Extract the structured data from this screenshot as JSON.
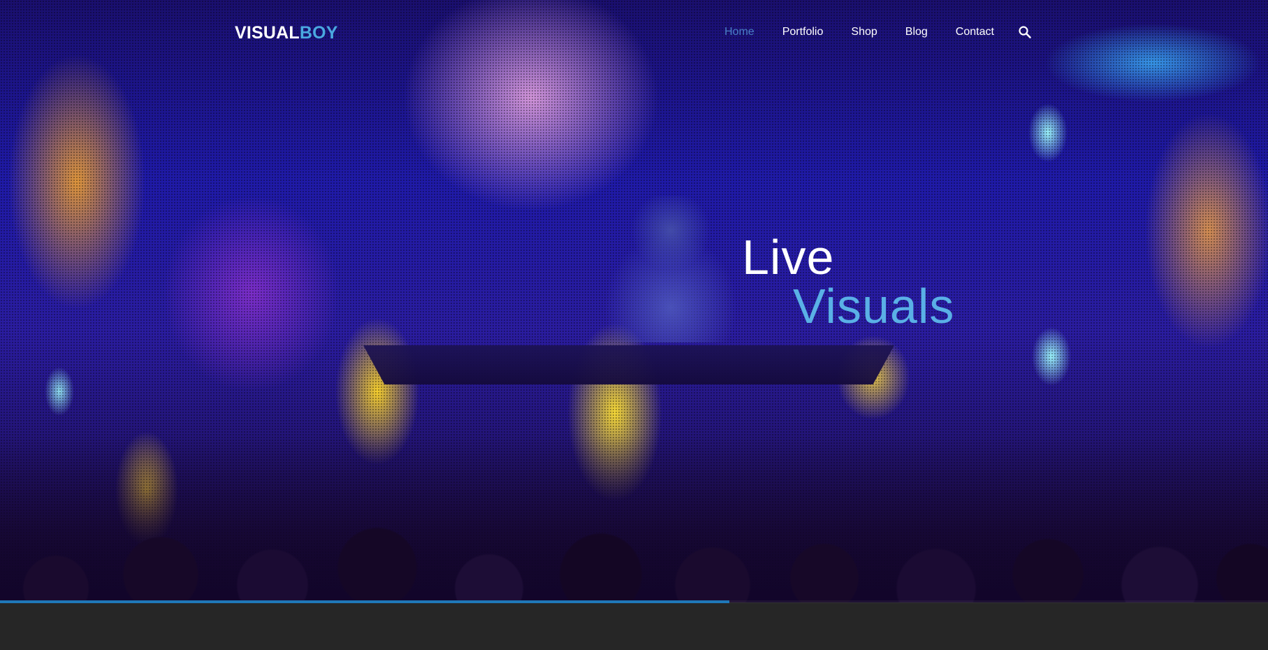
{
  "brand": {
    "part1": "VISUAL",
    "part2": "BOY"
  },
  "nav": {
    "items": [
      {
        "label": "Home",
        "active": true
      },
      {
        "label": "Portfolio",
        "active": false
      },
      {
        "label": "Shop",
        "active": false
      },
      {
        "label": "Blog",
        "active": false
      },
      {
        "label": "Contact",
        "active": false
      }
    ],
    "search_icon": "search-icon"
  },
  "hero": {
    "line1": "Live",
    "line2": "Visuals",
    "background": "dj-concert-photo"
  },
  "slider": {
    "progress": 0.575
  },
  "colors": {
    "accent": "#4aa8e0",
    "active_nav": "#4a7fc7",
    "progress": "#1f78b8",
    "footer_bg": "#262626"
  }
}
